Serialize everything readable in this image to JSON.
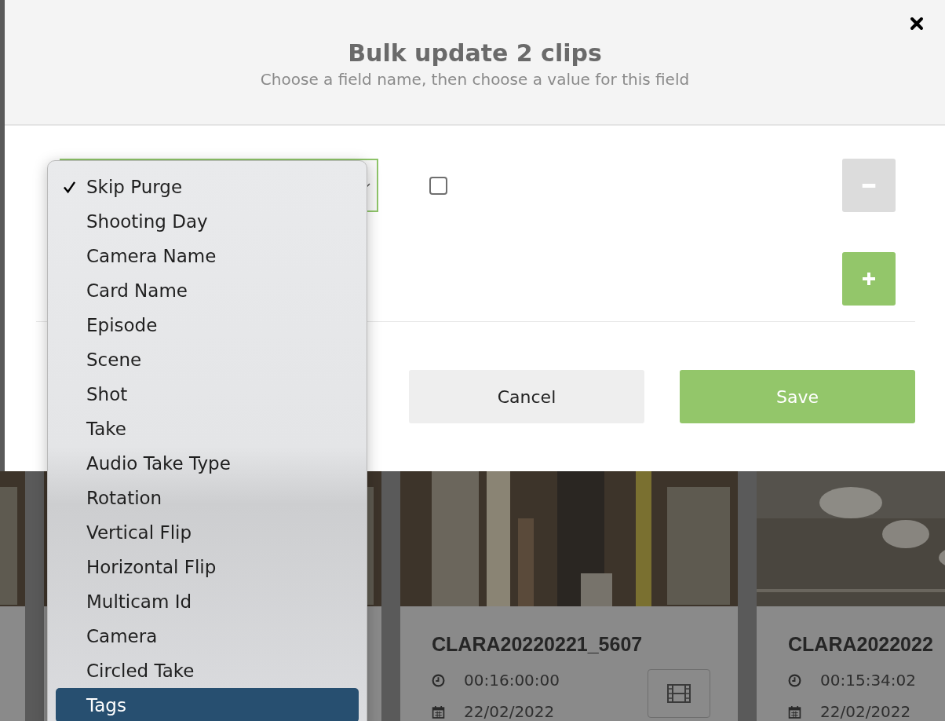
{
  "gallery": [
    {
      "kind": "covered"
    },
    {
      "kind": "covered"
    },
    {
      "kind": "clip",
      "title": "CLARA20220221_5607",
      "duration": "00:16:00:00",
      "date": "22/02/2022",
      "film_button": true
    },
    {
      "kind": "clip",
      "title": "CLARA2022022",
      "duration": "00:15:34:02",
      "date": "22/02/2022",
      "film_button": false
    }
  ],
  "modal": {
    "title": "Bulk update 2 clips",
    "subtitle": "Choose a field name, then choose a value for this field",
    "rows": [
      {
        "kind": "field",
        "value_checked": false
      }
    ],
    "buttons": [
      {
        "kind": "cancel",
        "label": "Cancel"
      },
      {
        "kind": "save",
        "label": "Save"
      }
    ]
  },
  "dropdown": {
    "options": [
      {
        "label": "Skip Purge",
        "checked": true,
        "selected": false
      },
      {
        "label": "Shooting Day",
        "checked": false,
        "selected": false
      },
      {
        "label": "Camera Name",
        "checked": false,
        "selected": false
      },
      {
        "label": "Card Name",
        "checked": false,
        "selected": false
      },
      {
        "label": "Episode",
        "checked": false,
        "selected": false
      },
      {
        "label": "Scene",
        "checked": false,
        "selected": false
      },
      {
        "label": "Shot",
        "checked": false,
        "selected": false
      },
      {
        "label": "Take",
        "checked": false,
        "selected": false
      },
      {
        "label": "Audio Take Type",
        "checked": false,
        "selected": false
      },
      {
        "label": "Rotation",
        "checked": false,
        "selected": false
      },
      {
        "label": "Vertical Flip",
        "checked": false,
        "selected": false
      },
      {
        "label": "Horizontal Flip",
        "checked": false,
        "selected": false
      },
      {
        "label": "Multicam Id",
        "checked": false,
        "selected": false
      },
      {
        "label": "Camera",
        "checked": false,
        "selected": false
      },
      {
        "label": "Circled Take",
        "checked": false,
        "selected": false
      },
      {
        "label": "Tags",
        "checked": false,
        "selected": true
      }
    ]
  }
}
